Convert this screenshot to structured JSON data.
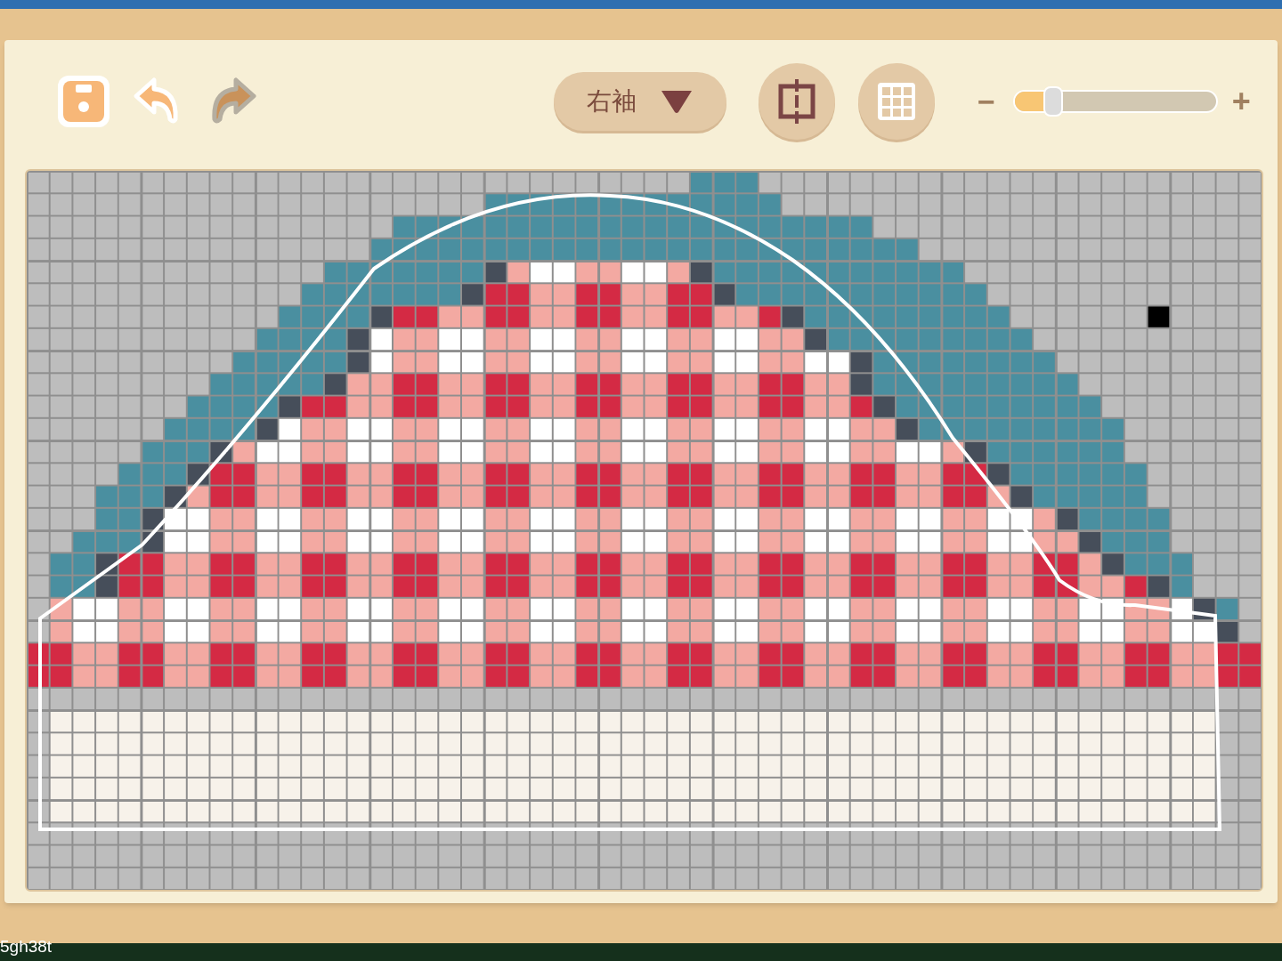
{
  "toolbar": {
    "undo": {
      "disabled": false
    },
    "redo": {
      "disabled": true
    },
    "part_dropdown": {
      "label": "右袖"
    },
    "zoom": {
      "minus": "−",
      "plus": "+",
      "level": 0.19
    }
  },
  "corner_text": "5gh38t"
}
